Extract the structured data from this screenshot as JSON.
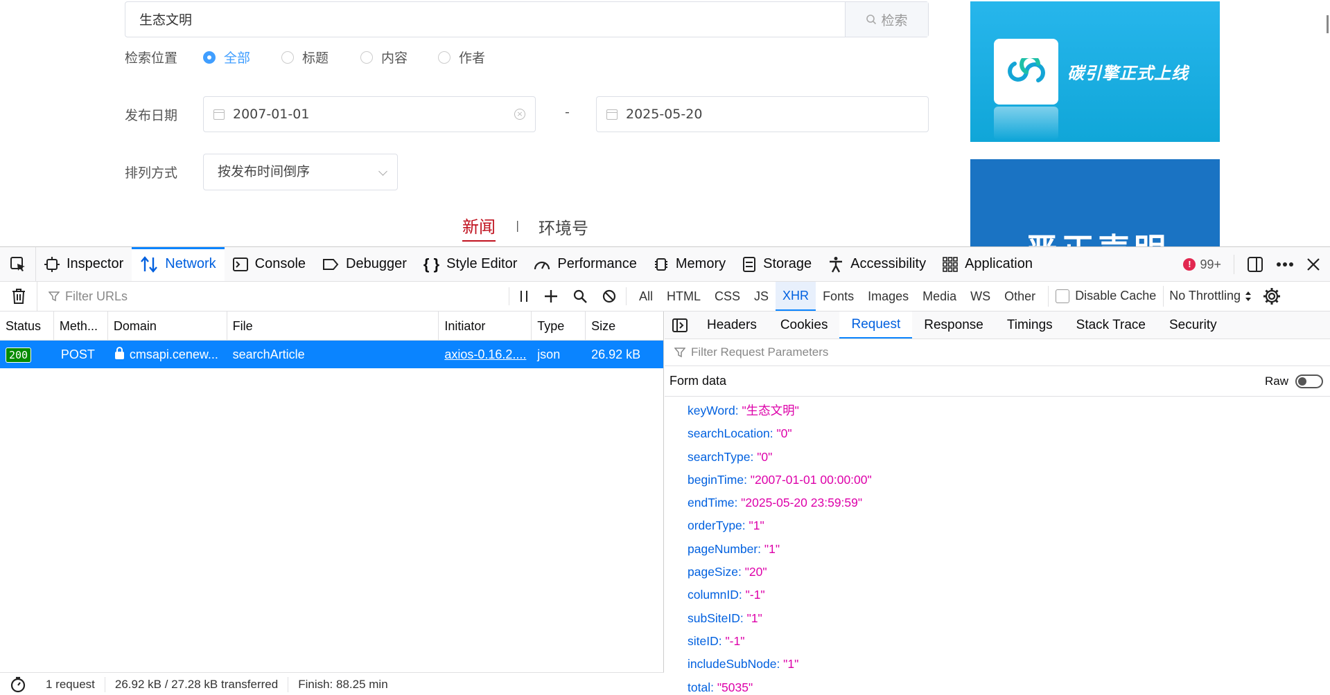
{
  "web": {
    "search": {
      "value": "生态文明",
      "button": "检索"
    },
    "location": {
      "label": "检索位置",
      "options": [
        "全部",
        "标题",
        "内容",
        "作者"
      ],
      "selected": "全部"
    },
    "date": {
      "label": "发布日期",
      "from": "2007-01-01",
      "sep": "-",
      "to": "2025-05-20"
    },
    "sort": {
      "label": "排列方式",
      "value": "按发布时间倒序"
    },
    "tabs": {
      "news": "新闻",
      "sep": "|",
      "env": "环境号"
    },
    "ads": {
      "ad1_text": "碳引擎正式上线",
      "ad2_text": "严正声明"
    }
  },
  "devtools": {
    "toolbox_tabs": [
      "Inspector",
      "Network",
      "Console",
      "Debugger",
      "Style Editor",
      "Performance",
      "Memory",
      "Storage",
      "Accessibility",
      "Application"
    ],
    "selected_tab": "Network",
    "error_count": "99+",
    "filter_placeholder": "Filter URLs",
    "type_filters": [
      "All",
      "HTML",
      "CSS",
      "JS",
      "XHR",
      "Fonts",
      "Images",
      "Media",
      "WS",
      "Other"
    ],
    "selected_type": "XHR",
    "disable_cache": "Disable Cache",
    "throttling": "No Throttling",
    "columns": [
      "Status",
      "Meth...",
      "Domain",
      "File",
      "Initiator",
      "Type",
      "Size"
    ],
    "requests": [
      {
        "status": "200",
        "method": "POST",
        "domain": "cmsapi.cenew...",
        "file": "searchArticle",
        "initiator": "axios-0.16.2....",
        "type": "json",
        "size": "26.92 kB"
      }
    ],
    "summary": {
      "requests": "1 request",
      "transferred": "26.92 kB / 27.28 kB transferred",
      "finish": "Finish: 88.25 min"
    },
    "detail_tabs": [
      "Headers",
      "Cookies",
      "Request",
      "Response",
      "Timings",
      "Stack Trace",
      "Security"
    ],
    "selected_detail": "Request",
    "param_filter_placeholder": "Filter Request Parameters",
    "form_data_label": "Form data",
    "raw_label": "Raw",
    "form_data": [
      {
        "key": "keyWord",
        "value": "\"生态文明\""
      },
      {
        "key": "searchLocation",
        "value": "\"0\""
      },
      {
        "key": "searchType",
        "value": "\"0\""
      },
      {
        "key": "beginTime",
        "value": "\"2007-01-01 00:00:00\""
      },
      {
        "key": "endTime",
        "value": "\"2025-05-20 23:59:59\""
      },
      {
        "key": "orderType",
        "value": "\"1\""
      },
      {
        "key": "pageNumber",
        "value": "\"1\""
      },
      {
        "key": "pageSize",
        "value": "\"20\""
      },
      {
        "key": "columnID",
        "value": "\"-1\""
      },
      {
        "key": "subSiteID",
        "value": "\"1\""
      },
      {
        "key": "siteID",
        "value": "\"-1\""
      },
      {
        "key": "includeSubNode",
        "value": "\"1\""
      },
      {
        "key": "total",
        "value": "\"5035\""
      }
    ],
    "colors": {
      "accent": "#0a84ff",
      "selected_text": "#0060df",
      "param_key": "#0060df",
      "param_value": "#dd00a9",
      "status_ok": "#058b00"
    }
  }
}
